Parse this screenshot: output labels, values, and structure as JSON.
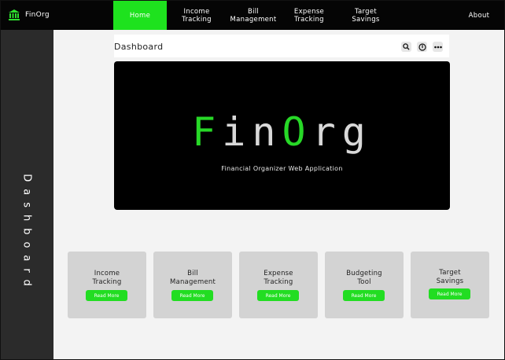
{
  "app": {
    "name": "FinOrg"
  },
  "nav": {
    "items": [
      {
        "label": "Home",
        "active": true
      },
      {
        "label": "Income\nTracking"
      },
      {
        "label": "Bill\nManagement"
      },
      {
        "label": "Expense\nTracking"
      },
      {
        "label": "Target\nSavings"
      }
    ],
    "about": "About"
  },
  "sidebar": {
    "title": "Dashboard"
  },
  "header": {
    "title": "Dashboard",
    "icons": [
      "search-icon",
      "info-icon",
      "more-icon"
    ]
  },
  "hero": {
    "title_green_1": "F",
    "title_white_1": "in",
    "title_green_2": "O",
    "title_white_2": "rg",
    "subtitle": "Financial Organizer Web Application"
  },
  "cards": [
    {
      "title": "Income\nTracking",
      "button": "Read More"
    },
    {
      "title": "Bill\nManagement",
      "button": "Read More"
    },
    {
      "title": "Expense\nTracking",
      "button": "Read More"
    },
    {
      "title": "Budgeting\nTool",
      "button": "Read More"
    },
    {
      "title": "Target\nSavings",
      "button": "Read More"
    }
  ],
  "colors": {
    "accent": "#1ee21e",
    "nav_bg": "#050505",
    "sidebar_bg": "#2b2b2b",
    "card_bg": "#d3d3d3"
  }
}
